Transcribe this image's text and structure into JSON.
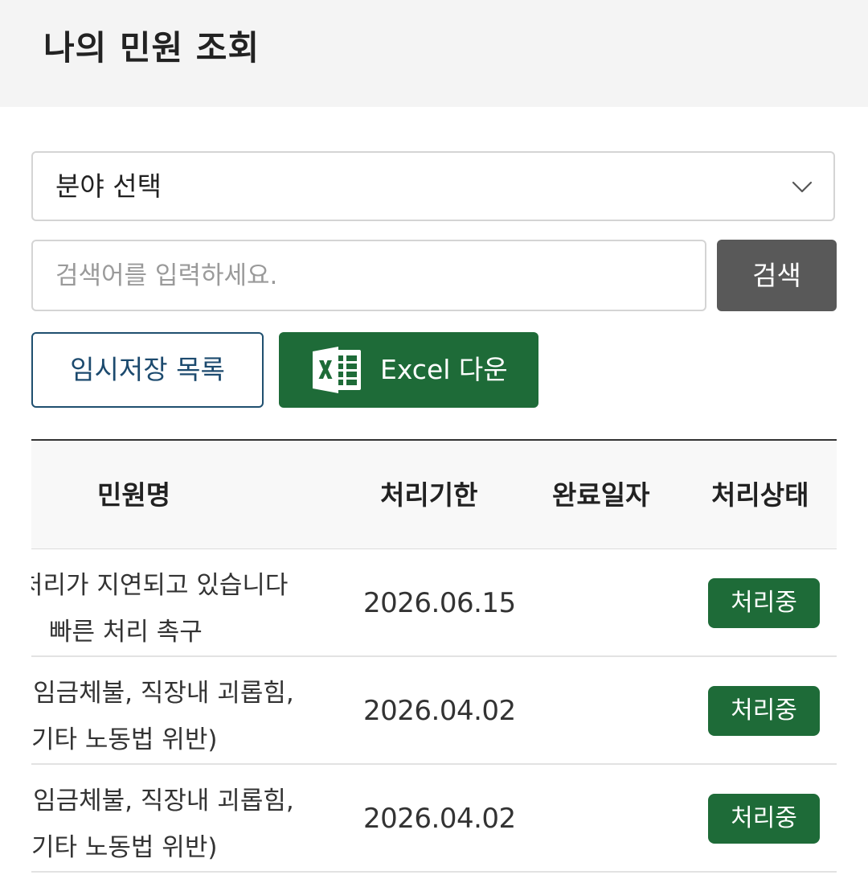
{
  "header": {
    "title": "나의 민원 조회"
  },
  "filters": {
    "field_select": {
      "value": "분야 선택"
    },
    "search": {
      "placeholder": "검색어를 입력하세요.",
      "value": "",
      "button_label": "검색"
    },
    "temp_save_button_label": "임시저장 목록",
    "excel_button_label": "Excel 다운",
    "excel_icon": "excel-icon"
  },
  "table": {
    "columns": [
      "민원명",
      "처리기한",
      "완료일자",
      "처리상태"
    ],
    "rows": [
      {
        "name_line1": "처리가 지연되고 있습니다",
        "name_line2": "빠른 처리 촉구",
        "deadline": "2026.06.15",
        "completed": "",
        "status": "처리중"
      },
      {
        "name_line1": "(임금체불, 직장내 괴롭힘,",
        "name_line2": "기타 노동법 위반)",
        "deadline": "2026.04.02",
        "completed": "",
        "status": "처리중"
      },
      {
        "name_line1": "(임금체불, 직장내 괴롭힘,",
        "name_line2": "기타 노동법 위반)",
        "deadline": "2026.04.02",
        "completed": "",
        "status": "처리중"
      }
    ]
  },
  "colors": {
    "primary_green": "#1e6b38",
    "search_button_gray": "#595959",
    "temp_button_navy": "#1c4a6e",
    "header_bg": "#f4f4f4"
  }
}
